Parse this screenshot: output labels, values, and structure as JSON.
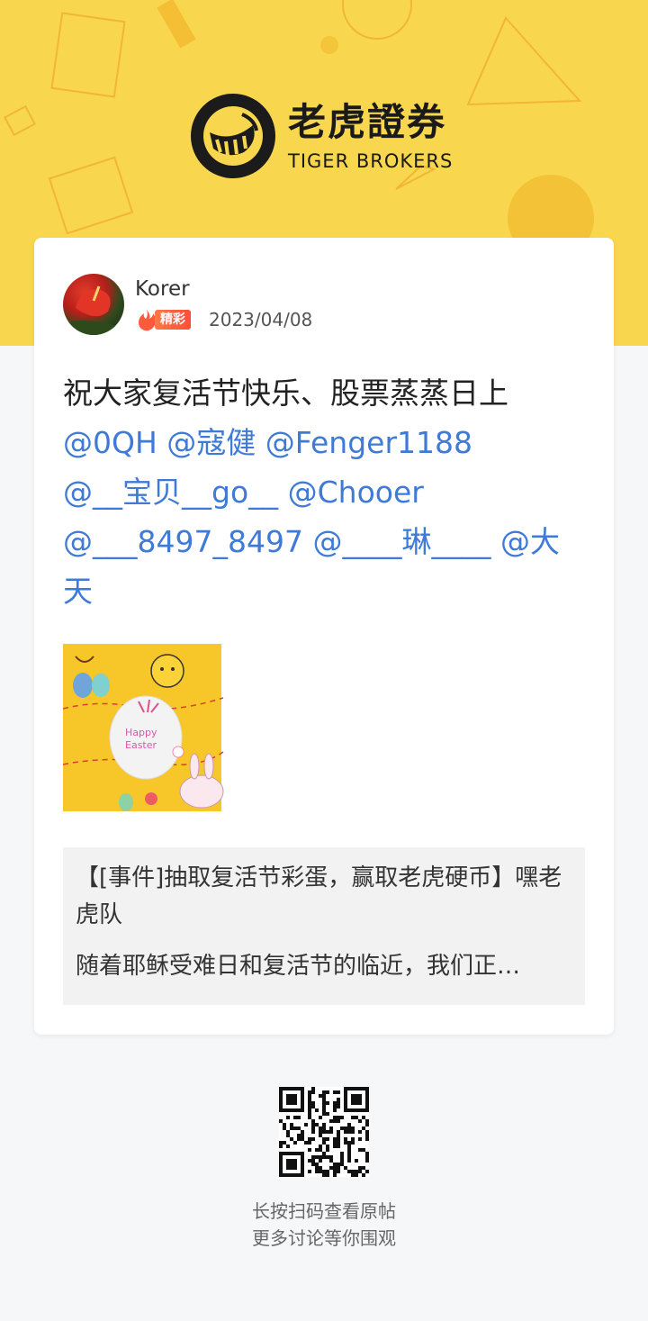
{
  "brand": {
    "name_cn": "老虎證券",
    "name_en": "TIGER BROKERS",
    "colors": {
      "hero_yellow": "#f8d64e",
      "mention_blue": "#3f7bd6",
      "badge_orange": "#ff5a3c"
    }
  },
  "post": {
    "author": "Korer",
    "badge": "精彩",
    "date": "2023/04/08",
    "text": "祝大家复活节快乐、股票蒸蒸日上",
    "mentions": [
      "@0QH",
      "@寇健",
      "@Fenger1188",
      "@__宝贝__go__",
      "@Chooer",
      "@___8497_8497",
      "@____琳____",
      "@大天"
    ],
    "image": {
      "caption_line1": "Happy",
      "caption_line2": "Easter"
    }
  },
  "linked_post": {
    "title": "【[事件]抽取复活节彩蛋，赢取老虎硬币】嘿老虎队",
    "body": "随着耶稣受难日和复活节的临近，我们正…"
  },
  "footer": {
    "line1": "长按扫码查看原帖",
    "line2": "更多讨论等你围观"
  }
}
